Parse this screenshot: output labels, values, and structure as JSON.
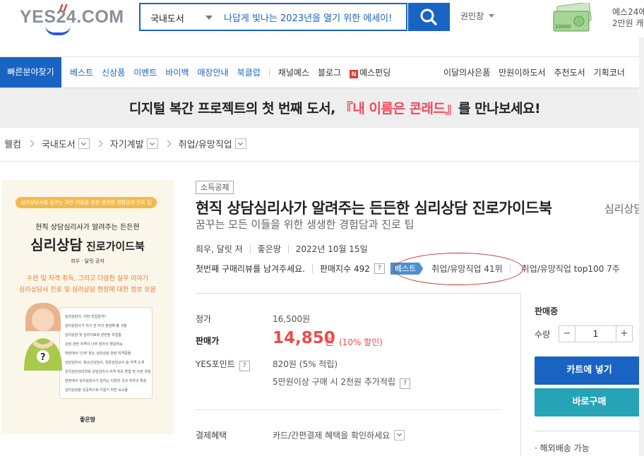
{
  "header": {
    "logo_text": "YES24.COM",
    "search_category": "국내도서",
    "search_value": "나답게 빛나는 2023년을 열기 위한 에세이!",
    "user_name": "권민창",
    "promo_line1": "예스24에",
    "promo_line2": "2만원 캐",
    "money_label": "10000",
    "accent_color": "#1964c2"
  },
  "nav": {
    "quick_menu": "빠른분야찾기",
    "items_left": [
      "베스트",
      "신상품",
      "이벤트",
      "바이백",
      "매장안내",
      "북클럽"
    ],
    "items_mid": [
      "채널예스",
      "블로그"
    ],
    "funding_logo": "N",
    "funding": "예스펀딩",
    "items_right": [
      "이달의사은품",
      "만원이하도서",
      "추천도서",
      "기획코너"
    ]
  },
  "event_banner": {
    "text_before": "디지털 복간 프로젝트의 첫 번째 도서, ",
    "text_highlight": "『내 이름은 콘래드』",
    "text_after": "를 만나보세요!"
  },
  "breadcrumb": [
    "웰컴",
    "국내도서",
    "자기계발",
    "취업/유망직업"
  ],
  "cover": {
    "badge": "심리상담사를 꿈꾸는 모든 이들을 위한 생생한 경험담과 진로 팁",
    "subtitle": "현직 상담심리사가 알려주는 든든한",
    "title_main": "심리상담",
    "title_rest": " 진로가이드북",
    "author": "희우 · 달릿 공저",
    "line1": "수련 및 자격 취득, 그리고 다양한 실무 이야기",
    "line2": "심리상담사 진로 및 심리상담 현장에 대한 정보 모음",
    "toc": [
      "심리상담사, 어떤 직업일까?",
      "심리상담사가 되기 전 미리 점검해 볼 것들",
      "심리상담 및 심리치료와 관련된 직업들",
      "상담 관련 자격이 너무 많아서 헷갈려요",
      "현장에서 '인싸' 받는 심리상담 관련 자격증들",
      "상담심리사, 청소년상담사, 전문상담교사 등 자격 소개",
      "한국상담심리학회 상담심리사 자격 취득 방법 및 수련 과정",
      "현장에서 심리상담사가 일하는 다양한 곳과 처우의 특징",
      "심리상담을 성공적으로 이끌기 위한 요소들"
    ],
    "publisher": "좋은땅"
  },
  "product": {
    "tag": "소득공제",
    "title": "현직 상담심리사가 알려주는 든든한 심리상담 진로가이드북",
    "title_suffix": "심리상담",
    "subtitle": "꿈꾸는 모든 이들을 위한 생생한 경험담과 진로 팁",
    "author": "희우, 달릿 저",
    "publisher": "좋은땅",
    "pub_date": "2022년 10월 15일",
    "review_prompt": "첫번째 구매리뷰를 남겨주세요.",
    "sales_index_label": "판매지수 492",
    "help_mark": "?",
    "best_badge": "베스트",
    "rank": "취업/유망직업 41위",
    "rank_top100": "취업/유망직업 top100 7주"
  },
  "price": {
    "list_label": "정가",
    "list_value": "16,500원",
    "sale_label": "판매가",
    "sale_value": "14,850",
    "sale_unit": "원",
    "discount": "(10% 할인)",
    "points_label": "YES포인트",
    "points_value": "820원 (5% 적립)",
    "extra_points": "5만원이상 구매 시 2천원 추가적립",
    "payment_label": "결제혜택",
    "payment_value": "카드/간편결제 혜택을 확인하세요"
  },
  "panel": {
    "status": "판매중",
    "qty_label": "수량",
    "qty_value": "1",
    "minus": "−",
    "plus": "+",
    "cart_button": "카트에 넣기",
    "buy_button": "바로구매",
    "overseas": "· 해외배송 가능"
  }
}
